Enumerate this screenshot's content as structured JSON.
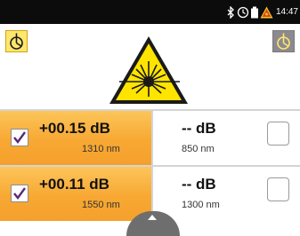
{
  "status": {
    "time": "14:47",
    "icons": [
      "bluetooth-icon",
      "timer-icon",
      "battery-icon",
      "laser-warning-icon"
    ]
  },
  "header": {
    "left_button_icon": "power-source-icon",
    "right_button_icon": "power-source-icon",
    "warning_icon": "laser-hazard-icon"
  },
  "measurements": [
    {
      "left": {
        "value": "+00.15 dB",
        "wavelength": "1310 nm",
        "checked": true
      },
      "right": {
        "value": "-- dB",
        "wavelength": "850 nm",
        "checked": false
      }
    },
    {
      "left": {
        "value": "+00.11 dB",
        "wavelength": "1550 nm",
        "checked": true
      },
      "right": {
        "value": "-- dB",
        "wavelength": "1300 nm",
        "checked": false
      }
    }
  ],
  "colors": {
    "highlight": "#f7a833",
    "status_bar": "#0c0c0c",
    "active_button": "#ffe66d",
    "inactive_button": "#8c8a8e"
  }
}
